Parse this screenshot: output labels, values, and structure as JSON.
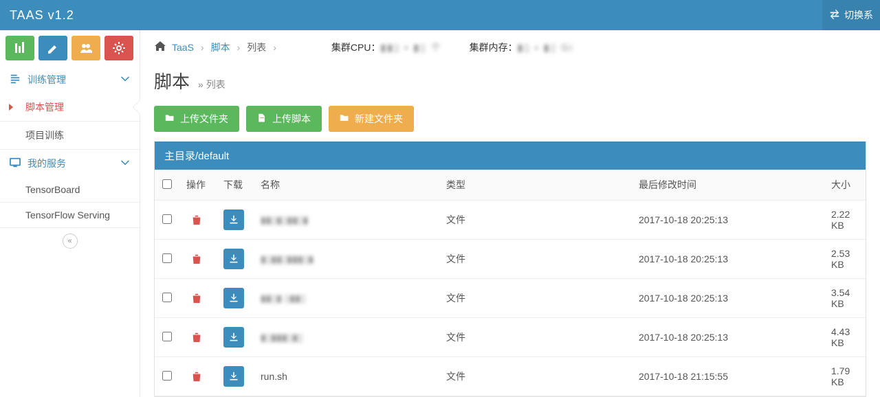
{
  "brand": "TAAS v1.2",
  "switch_label": "切换系",
  "sidebar": {
    "section1": {
      "title": "训练管理",
      "items": [
        "脚本管理",
        "项目训练"
      ],
      "active_index": 0
    },
    "section2": {
      "title": "我的服务",
      "items": [
        "TensorBoard",
        "TensorFlow Serving"
      ]
    }
  },
  "breadcrumb": {
    "root": "TaaS",
    "mid": "脚本",
    "leaf": "列表"
  },
  "stats": {
    "cpu_label": "集群CPU：",
    "cpu_value": "▮▮▯ ▪ ▮▯ 个",
    "mem_label": "集群内存：",
    "mem_value": "▮▯ ▪ ▮▯ Gi"
  },
  "page": {
    "title": "脚本",
    "sub": "» 列表"
  },
  "buttons": {
    "upload_folder": "上传文件夹",
    "upload_script": "上传脚本",
    "new_folder": "新建文件夹"
  },
  "table": {
    "header_bar": "主目录/default",
    "cols": {
      "op": "操作",
      "dl": "下载",
      "name": "名称",
      "type": "类型",
      "time": "最后修改时间",
      "size": "大小"
    },
    "rows": [
      {
        "name": "▮▮▯▮▯▮▮▯▮",
        "blur": true,
        "type": "文件",
        "time": "2017-10-18 20:25:13",
        "size": "2.22 KB"
      },
      {
        "name": "▮▯▮▮▯▮▮▮▯▮",
        "blur": true,
        "type": "文件",
        "time": "2017-10-18 20:25:13",
        "size": "2.53 KB"
      },
      {
        "name": "▮▮▯▮ ▯▮▮▯",
        "blur": true,
        "type": "文件",
        "time": "2017-10-18 20:25:13",
        "size": "3.54 KB"
      },
      {
        "name": "▮▯▮▮▮▯▮▯",
        "blur": true,
        "type": "文件",
        "time": "2017-10-18 20:25:13",
        "size": "4.43 KB"
      },
      {
        "name": "run.sh",
        "blur": false,
        "type": "文件",
        "time": "2017-10-18 21:15:55",
        "size": "1.79 KB"
      }
    ]
  }
}
